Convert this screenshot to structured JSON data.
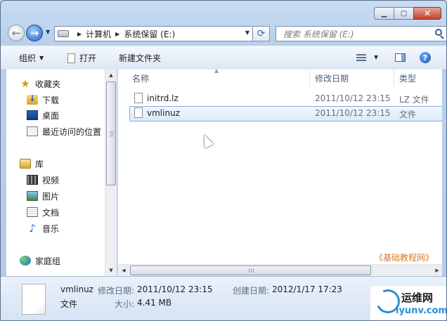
{
  "window": {
    "caption_min": "▁",
    "caption_max": "▢",
    "caption_close": "✕"
  },
  "address": {
    "crumbs": [
      "计算机",
      "系统保留 (E:)"
    ],
    "sep": "▶",
    "dropdown": "▼"
  },
  "search": {
    "placeholder": "搜索 系统保留 (E:)"
  },
  "commands": {
    "organize": "组织",
    "open": "打开",
    "new_folder": "新建文件夹",
    "help": "?"
  },
  "nav": {
    "favorites": "收藏夹",
    "downloads": "下载",
    "desktop": "桌面",
    "recent": "最近访问的位置",
    "libraries": "库",
    "videos": "视频",
    "pictures": "图片",
    "documents": "文档",
    "music": "音乐",
    "homegroup": "家庭组"
  },
  "columns": {
    "name": "名称",
    "date": "修改日期",
    "type": "类型"
  },
  "files": [
    {
      "name": "initrd.lz",
      "date": "2011/10/12 23:15",
      "type": "LZ 文件"
    },
    {
      "name": "vmlinuz",
      "date": "2011/10/12 23:15",
      "type": "文件"
    }
  ],
  "watermark": "《基础教程网》",
  "details": {
    "name": "vmlinuz",
    "type": "文件",
    "modified_label": "修改日期:",
    "modified": "2011/10/12 23:15",
    "created_label": "创建日期:",
    "created": "2012/1/17 17:23",
    "size_label": "大小:",
    "size": "4.41 MB"
  },
  "logo": {
    "line1": "运维网",
    "line2": "iyunv.com"
  },
  "colors": {
    "accent": "#2a8fd6",
    "selection_border": "#84acdd",
    "watermark": "#e07a20"
  }
}
